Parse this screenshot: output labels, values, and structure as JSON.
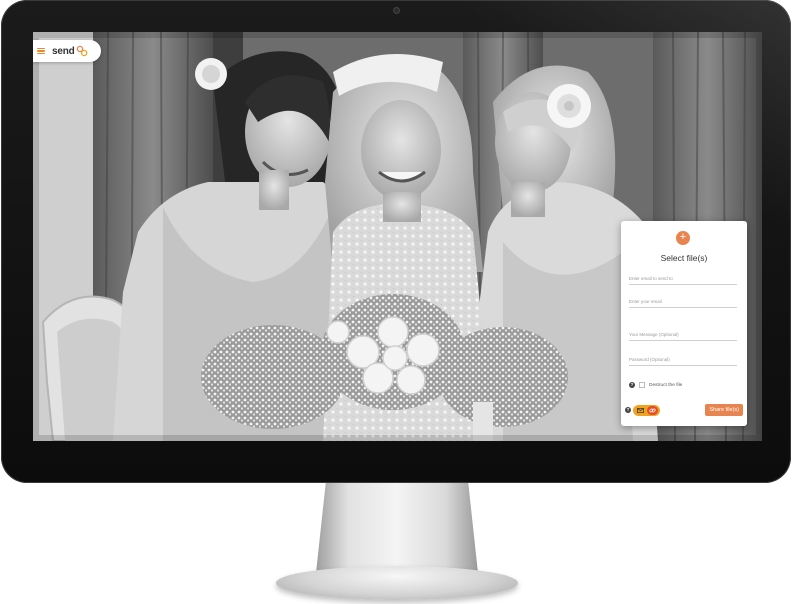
{
  "app": {
    "brand_name": "send",
    "accent_color": "#e7844f",
    "brand_color": "#f0a31f"
  },
  "header": {
    "menu_icon": "hamburger-menu-icon",
    "logo_icon": "send-logo-icon"
  },
  "upload_card": {
    "add_icon": "plus-icon",
    "add_symbol": "+",
    "title": "Select file(s)",
    "fields": {
      "email_to_placeholder": "Enter email to send to",
      "your_email_placeholder": "Enter your email",
      "message_placeholder": "Your Message (Optional)",
      "password_placeholder": "Password (Optional)"
    },
    "destruct_help_symbol": "?",
    "destruct_label": "Destruct the file",
    "footer": {
      "help_symbol": "?",
      "mode_email_icon": "envelope-icon",
      "mode_link_icon": "link-icon",
      "share_label": "Share file(s)"
    }
  }
}
